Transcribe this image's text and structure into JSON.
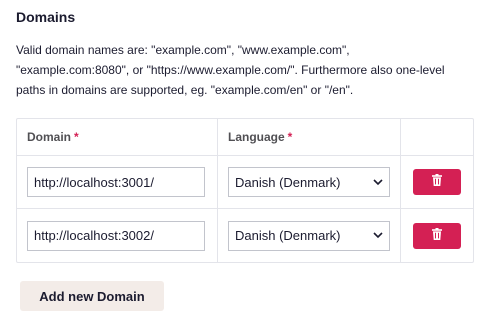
{
  "section": {
    "title": "Domains",
    "description_line1": "Valid domain names are: \"example.com\", \"www.example.com\",",
    "description_line2": "\"example.com:8080\", or \"https://www.example.com/\". Furthermore also one-level",
    "description_line3": "paths in domains are supported, eg. \"example.com/en\" or \"/en\"."
  },
  "table": {
    "headers": {
      "domain": "Domain",
      "language": "Language",
      "required_marker": "*"
    },
    "rows": [
      {
        "domain": "http://localhost:3001/",
        "language": "Danish (Denmark)"
      },
      {
        "domain": "http://localhost:3002/",
        "language": "Danish (Denmark)"
      }
    ]
  },
  "actions": {
    "add_domain_label": "Add new Domain"
  },
  "colors": {
    "danger": "#d42054",
    "secondary_button": "#f3ece8",
    "border": "#e3e4ea"
  },
  "icons": {
    "delete": "trash-icon",
    "select": "chevron-down-icon"
  }
}
